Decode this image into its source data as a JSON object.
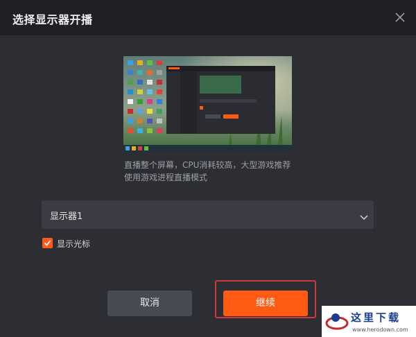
{
  "dialog": {
    "title": "选择显示器开播",
    "description": "直播整个屏幕，CPU消耗较高，大型游戏推荐使用游戏进程直播模式",
    "display_select": {
      "selected": "显示器1"
    },
    "checkbox": {
      "label": "显示光标",
      "checked": true
    },
    "buttons": {
      "cancel": "取消",
      "continue": "继续"
    }
  },
  "colors": {
    "accent": "#ff5a14",
    "highlight": "#d13a3a"
  },
  "watermark": {
    "text": "这里下载",
    "url": "www.herodown.com"
  },
  "icons": {
    "close": "close-icon",
    "caret": "chevron-down-icon",
    "check": "checkmark-icon"
  }
}
